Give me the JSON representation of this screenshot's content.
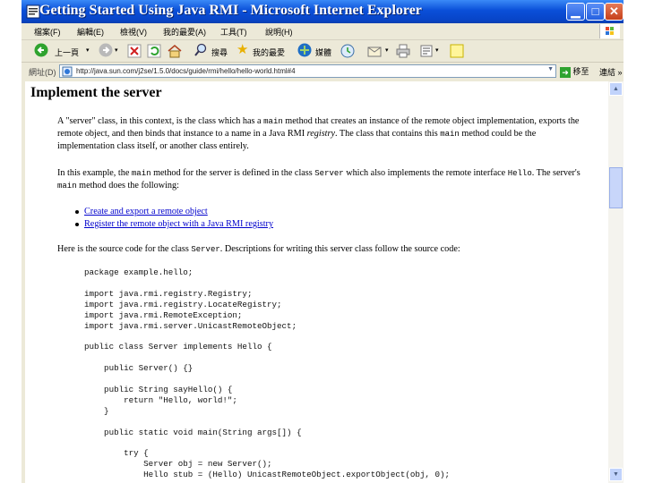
{
  "window": {
    "title": "Getting Started Using Java RMI - Microsoft Internet Explorer",
    "minimize_glyph": "▁",
    "maximize_glyph": "□",
    "close_glyph": "✕"
  },
  "menu": [
    "檔案(F)",
    "編輯(E)",
    "檢視(V)",
    "我的最愛(A)",
    "工具(T)",
    "說明(H)"
  ],
  "toolbar": {
    "back": "上一頁",
    "search": "搜尋",
    "favorites": "我的最愛",
    "media": "媒體",
    "history_icon": "history-icon",
    "mail_icon": "mail-icon",
    "print_icon": "print-icon",
    "edit_icon": "edit-icon"
  },
  "address": {
    "label": "網址(D)",
    "url": "http://java.sun.com/j2se/1.5.0/docs/guide/rmi/hello/hello-world.html#4",
    "go": "移至",
    "links": "連結 »"
  },
  "page": {
    "heading": "Implement the server",
    "p1_parts": [
      "A \"server\" class, in this context, is the class which has a ",
      "main",
      " method that creates an instance of the remote object implementation, exports the remote object, and then binds that instance to a name in a Java RMI ",
      "registry",
      ". The class that contains this ",
      "main",
      " method could be the implementation class itself, or another class entirely."
    ],
    "p2_parts": [
      "In this example, the ",
      "main",
      " method for the server is defined in the class ",
      "Server",
      " which also implements the remote interface ",
      "Hello",
      ". The server's ",
      "main",
      " method does the following:"
    ],
    "list": [
      "Create and export a remote object",
      "Register the remote object with a Java RMI registry"
    ],
    "p3_parts": [
      "Here is the source code for the class ",
      "Server",
      ". Descriptions for writing this server class follow the source code:"
    ],
    "code": "package example.hello;\n\nimport java.rmi.registry.Registry;\nimport java.rmi.registry.LocateRegistry;\nimport java.rmi.RemoteException;\nimport java.rmi.server.UnicastRemoteObject;\n\npublic class Server implements Hello {\n\n    public Server() {}\n\n    public String sayHello() {\n        return \"Hello, world!\";\n    }\n\n    public static void main(String args[]) {\n\n        try {\n            Server obj = new Server();\n            Hello stub = (Hello) UnicastRemoteObject.exportObject(obj, 0);"
  },
  "colors": {
    "titlebar": "#0A4FD8",
    "chrome": "#ECE9D8",
    "link": "#0000CC"
  }
}
